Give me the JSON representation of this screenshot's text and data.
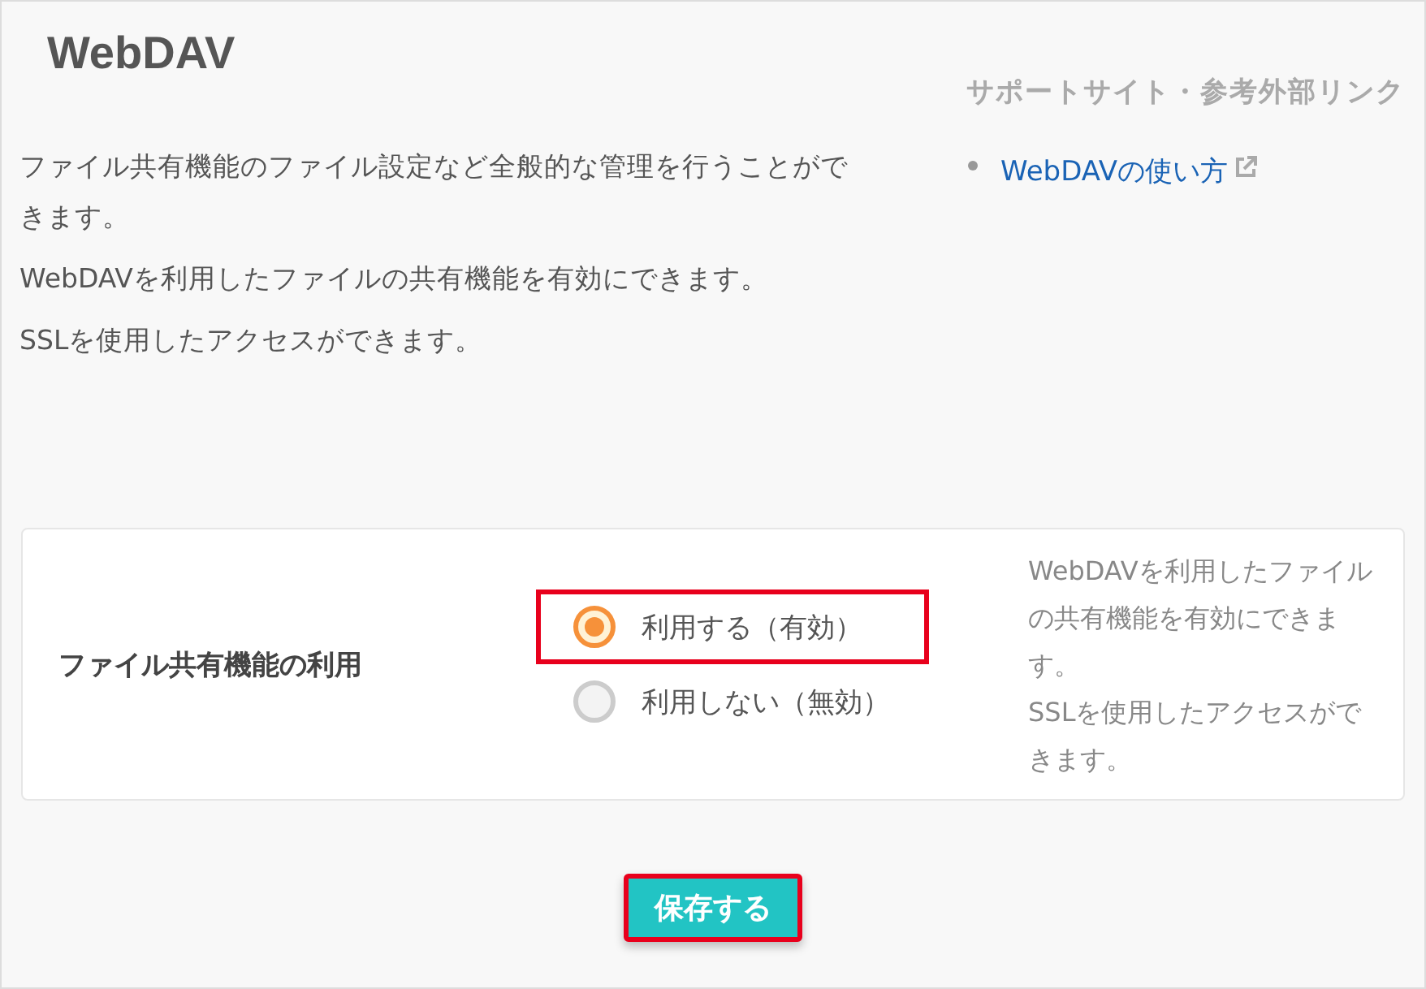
{
  "title": "WebDAV",
  "description": [
    "ファイル共有機能のファイル設定など全般的な管理を行うことができます。",
    "WebDAVを利用したファイルの共有機能を有効にできます。",
    "SSLを使用したアクセスができます。"
  ],
  "support": {
    "heading": "サポートサイト・参考外部リンク",
    "links": [
      {
        "label": "WebDAVの使い方",
        "external": true
      }
    ]
  },
  "setting": {
    "label": "ファイル共有機能の利用",
    "options": [
      {
        "label": "利用する（有効）",
        "selected": true,
        "highlighted": true
      },
      {
        "label": "利用しない（無効）",
        "selected": false,
        "highlighted": false
      }
    ],
    "help": [
      "WebDAVを利用したファイルの共有機能を有効にできます。",
      "SSLを使用したアクセスができます。"
    ]
  },
  "save_button": {
    "label": "保存する",
    "highlighted": true
  }
}
